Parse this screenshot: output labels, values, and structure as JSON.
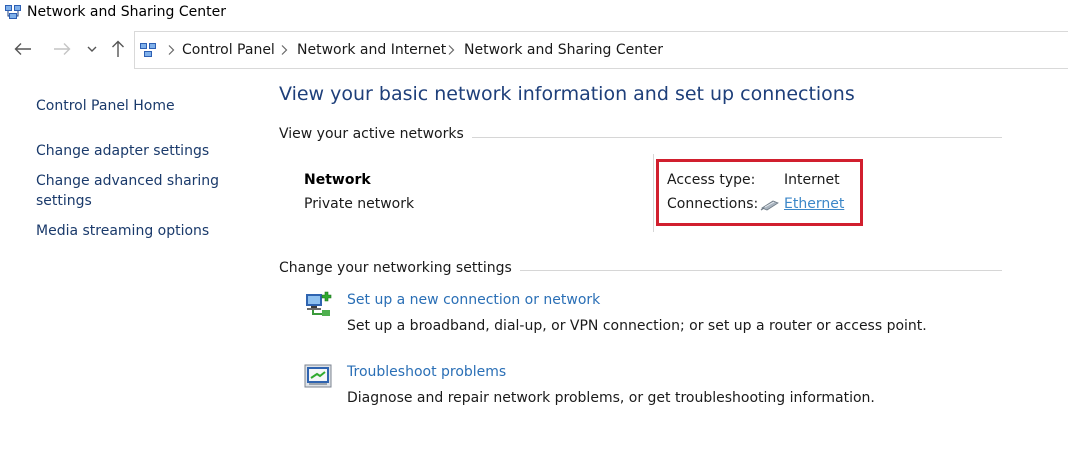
{
  "window": {
    "title": "Network and Sharing Center",
    "icon": "network-center-icon"
  },
  "nav": {
    "back_icon": "back-arrow-icon",
    "forward_icon": "forward-arrow-icon",
    "recent_icon": "chevron-down-icon",
    "up_icon": "up-arrow-icon"
  },
  "breadcrumb": {
    "items": [
      "Control Panel",
      "Network and Internet",
      "Network and Sharing Center"
    ]
  },
  "sidebar": {
    "items": [
      {
        "label": "Control Panel Home"
      },
      {
        "label": "Change adapter settings"
      },
      {
        "label": "Change advanced sharing",
        "label_line2": "settings"
      },
      {
        "label": "Media streaming options"
      }
    ]
  },
  "main": {
    "title": "View your basic network information and set up connections",
    "active_networks_heading": "View your active networks",
    "network": {
      "name": "Network",
      "type": "Private network",
      "access_type_label": "Access type:",
      "access_type_value": "Internet",
      "connections_label": "Connections:",
      "connection_name": "Ethernet",
      "connection_icon": "ethernet-icon"
    },
    "change_settings_heading": "Change your networking settings",
    "tasks": [
      {
        "label": "Set up a new connection or network",
        "description": "Set up a broadband, dial-up, or VPN connection; or set up a router or access point.",
        "icon": "new-connection-icon"
      },
      {
        "label": "Troubleshoot problems",
        "description": "Diagnose and repair network problems, or get troubleshooting information.",
        "icon": "troubleshoot-icon"
      }
    ]
  },
  "colors": {
    "link": "#2a6fb6",
    "title": "#1e3f7a",
    "highlight": "#d11f2e"
  }
}
